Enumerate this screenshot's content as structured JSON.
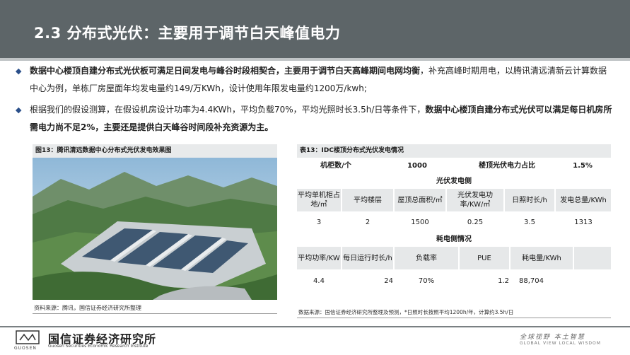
{
  "header": {
    "title": "2.3 分布式光伏：主要用于调节白天峰值电力"
  },
  "bullets": [
    {
      "bold": "数据中心楼顶自建分布式光伏板可满足日间发电与峰谷时段相契合，主要用于调节白天高峰期间电网均衡",
      "normal": "，补充高峰时期用电，以腾讯清远清新云计算数据中心为例，单栋厂房屋面年均发电量约149/万KWh，设计使用年限发电量约1200万/kwh;"
    },
    {
      "normal": "根据我们的假设测算，在假设机房设计功率为4.4KWh，平均负载70%，平均光照时长3.5h/日等条件下，",
      "bold": "数据中心楼顶自建分布式光伏可以满足每日机房所需电力尚不足2%，主要还是提供白天峰谷时间段补充资源为主。"
    }
  ],
  "figure": {
    "title": "图13：腾讯清远数据中心分布式光伏发电效果图",
    "source": "资料来源：腾讯，国信证券经济研究所整理"
  },
  "table": {
    "title": "表13：IDC楼顶分布式光伏发电情况",
    "top_row": [
      "机柜数/个",
      "1000",
      "楼顶光伏电力占比",
      "1.5%"
    ],
    "pv_section": "光伏发电侧",
    "pv_headers": [
      "平均单机柜占地/㎡",
      "平均楼层",
      "屋顶总面积/㎡",
      "光伏发电功率/KW/㎡",
      "日照时长/h",
      "发电总量/KWh"
    ],
    "pv_values": [
      "3",
      "2",
      "1500",
      "0.25",
      "3.5",
      "1313"
    ],
    "cons_section": "耗电侧情况",
    "cons_headers": [
      "平均功率/KW",
      "每日运行时长/h",
      "负载率",
      "PUE",
      "耗电量/KWh"
    ],
    "cons_values": [
      "4.4",
      "24",
      "70%",
      "1.2",
      "88,704"
    ],
    "source": "数据来源：国信证券经济研究所整理及预测，*日照时长按照平均1200h/年，计算约3.5h/日"
  },
  "footer": {
    "company": "国信证券经济研究所",
    "company_en": "Guosen Securities Economic Research Institute",
    "brand": "GUOSEN",
    "slogan": "全球视野  本土智慧",
    "slogan_en": "GLOBAL VIEW    LOCAL WISDOM"
  },
  "colors": {
    "header_bg": "#5d6568",
    "bullet": "#2a4f8a",
    "table_shade": "#e6e8e9"
  }
}
